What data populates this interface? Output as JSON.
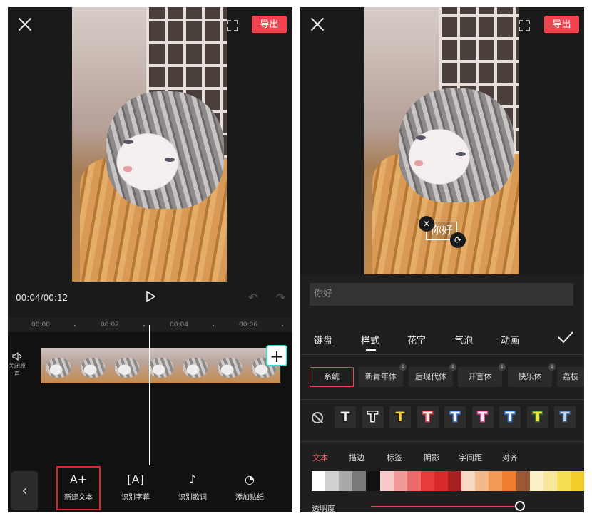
{
  "left": {
    "export_label": "导出",
    "time": "00:04/00:12",
    "ruler": [
      "00:00",
      "00:02",
      "00:04",
      "00:06"
    ],
    "audio_label": "关闭原声",
    "back_icon": "‹",
    "tools": [
      {
        "icon": "A+",
        "label": "新建文本"
      },
      {
        "icon": "[A]",
        "label": "识别字幕"
      },
      {
        "icon": "♪",
        "label": "识别歌词"
      },
      {
        "icon": "◔",
        "label": "添加贴纸"
      }
    ]
  },
  "right": {
    "export_label": "导出",
    "overlay_text": "你好",
    "input_value": "你好",
    "tabs": [
      "键盘",
      "样式",
      "花字",
      "气泡",
      "动画"
    ],
    "fonts": [
      "系统",
      "新青年体",
      "后现代体",
      "开言体",
      "快乐体",
      "荔枝"
    ],
    "style_glyph": "T",
    "style_colors": [
      {
        "fill": "#f2f2f2",
        "stroke": "#1a1a1a"
      },
      {
        "fill": "#1a1a1a",
        "stroke": "#f2f2f2"
      },
      {
        "fill": "#f3d23a",
        "stroke": "#1a1a1a"
      },
      {
        "fill": "#f2f2f2",
        "stroke": "#e0474f"
      },
      {
        "fill": "#f2f2f2",
        "stroke": "#4a7fd6"
      },
      {
        "fill": "#f2f2f2",
        "stroke": "#e64c9a"
      },
      {
        "fill": "#f2f2f2",
        "stroke": "#2f7de8"
      },
      {
        "fill": "#f3e33a",
        "stroke": "#3a7a2c"
      },
      {
        "fill": "#c9d6e6",
        "stroke": "#3b5f8a"
      }
    ],
    "subtabs": [
      "文本",
      "描边",
      "标签",
      "阴影",
      "字间距",
      "对齐"
    ],
    "palette": [
      "#ffffff",
      "#d0d0d0",
      "#a8a8a8",
      "#7a7a7a",
      "#111111",
      "#f7c9c9",
      "#f29a9a",
      "#eb6a6a",
      "#e53b3b",
      "#d92b2b",
      "#a81f1f",
      "#f7d9c4",
      "#f5b889",
      "#f29a55",
      "#ef7e2e",
      "#9a5a3a",
      "#fbf1c7",
      "#f9e79a",
      "#f6de55",
      "#f2cf2a"
    ],
    "opacity_label": "透明度",
    "opacity_value": 0.97
  }
}
